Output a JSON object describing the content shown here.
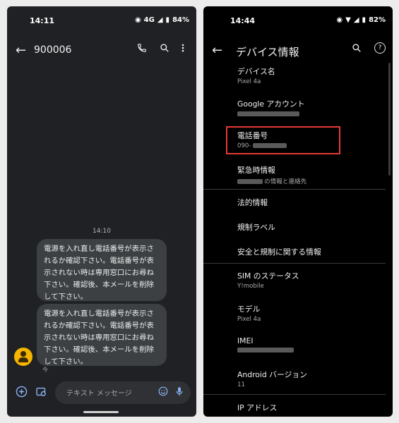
{
  "left": {
    "status": {
      "time": "14:11",
      "network": "4G",
      "battery": "84%"
    },
    "header": {
      "title": "900006"
    },
    "icons": {
      "back": "arrow-back-icon",
      "call": "phone-icon",
      "search": "search-icon",
      "more": "more-vert-icon"
    },
    "timestamp": "14:10",
    "messages": [
      "電源を入れ直し電話番号が表示されるか確認下さい。電話番号が表示されない時は専用窓口にお尋ね下さい。確認後、本メールを削除して下さい。",
      "電源を入れ直し電話番号が表示されるか確認下さい。電話番号が表示されない時は専用窓口にお尋ね下さい。確認後、本メールを削除して下さい。"
    ],
    "message_state": "今",
    "composer": {
      "placeholder": "テキスト メッセージ"
    },
    "avatar_color": "#f4b400"
  },
  "right": {
    "status": {
      "time": "14:44",
      "battery": "82%"
    },
    "header": {
      "title": "デバイス情報"
    },
    "items": [
      {
        "title": "デバイス名",
        "sub": "Pixel 4a"
      },
      {
        "title": "Google アカウント",
        "sub": ""
      },
      {
        "title": "電話番号",
        "sub": "090-"
      },
      {
        "title": "緊急時情報",
        "sub": "の情報と連絡先"
      },
      {
        "title": "法的情報",
        "sub": ""
      },
      {
        "title": "規制ラベル",
        "sub": ""
      },
      {
        "title": "安全と規制に関する情報",
        "sub": ""
      },
      {
        "title": "SIM のステータス",
        "sub": "Y!mobile"
      },
      {
        "title": "モデル",
        "sub": "Pixel 4a"
      },
      {
        "title": "IMEI",
        "sub": ""
      },
      {
        "title": "Android バージョン",
        "sub": "11"
      },
      {
        "title": "IP アドレス",
        "sub": ""
      }
    ],
    "highlight_color": "#e53935"
  }
}
